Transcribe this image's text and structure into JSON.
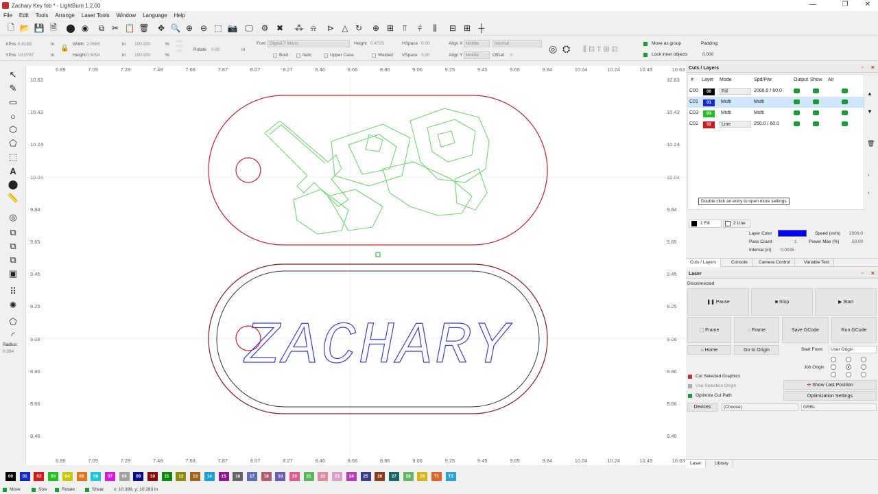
{
  "window": {
    "title": "Zachary Key fob * - LightBurn 1.2.00",
    "minimize": "—",
    "maximize": "❐",
    "close": "✕"
  },
  "menu": [
    "File",
    "Edit",
    "Tools",
    "Arrange",
    "Laser Tools",
    "Window",
    "Language",
    "Help"
  ],
  "toolbar2": {
    "xpos_label": "XPos",
    "xpos_value": "6.8189",
    "xpos_unit": "in",
    "ypos_label": "YPos",
    "ypos_value": "10.0787",
    "ypos_unit": "in",
    "width_label": "Width",
    "width_value": "2.0665",
    "width_unit": "in",
    "width_pct": "100.000",
    "width_pct_unit": "%",
    "height_label": "Height",
    "height_value": "0.9094",
    "height_unit": "in",
    "height_pct": "100.000",
    "height_pct_unit": "%",
    "rotate_label": "Rotate",
    "rotate_value": "0.00",
    "rotate_unit": "in",
    "font_label": "Font",
    "font_value": "Digital-7 Mono",
    "fheight_label": "Height",
    "fheight_value": "0.4725",
    "hspace_label": "HSpace",
    "hspace_value": "0.00",
    "vspace_label": "VSpace",
    "vspace_value": "0.00",
    "bold": "Bold",
    "italic": "Italic",
    "upper": "Upper Case",
    "welded": "Welded",
    "alignx_label": "Align X",
    "alignx_value": "Middle",
    "aligny_label": "Align Y",
    "aligny_value": "Middle",
    "normal": "Normal",
    "offset_label": "Offset",
    "offset_value": "0",
    "move_group": "Move as group",
    "lock_inner": "Lock inner objects",
    "padding_label": "Padding:",
    "padding_value": "0.000"
  },
  "rulers": {
    "top": [
      "6.89",
      "7.09",
      "7.28",
      "7.48",
      "7.68",
      "7.87",
      "8.07",
      "8.27",
      "8.46",
      "8.66",
      "8.86",
      "9.06",
      "9.25",
      "9.45",
      "9.65",
      "9.84",
      "10.04",
      "10.24",
      "10.43",
      "10.63"
    ],
    "left": [
      "10.63",
      "10.43",
      "10.24",
      "10.04",
      "9.84",
      "9.65",
      "9.45",
      "9.25",
      "9.06",
      "8.86",
      "8.66",
      "8.46"
    ]
  },
  "canvas": {
    "name_text": "ZACHARY"
  },
  "left_tools": {
    "radius_label": "Radius:",
    "radius_value": "0.394"
  },
  "cuts_layers": {
    "title": "Cuts / Layers",
    "headers": {
      "num": "#",
      "layer": "Layer",
      "mode": "Mode",
      "spdpwr": "Spd/Pwr",
      "output": "Output",
      "show": "Show",
      "air": "Air"
    },
    "rows": [
      {
        "num": "C00",
        "layer": "00",
        "mode": "Fill",
        "spdpwr": "2000.0 / 60.0",
        "color": "#000000"
      },
      {
        "num": "C01",
        "layer": "01",
        "mode": "Multi",
        "spdpwr": "Multi",
        "color": "#1428d8"
      },
      {
        "num": "C03",
        "layer": "03",
        "mode": "Multi",
        "spdpwr": "Multi",
        "color": "#22c022"
      },
      {
        "num": "C02",
        "layer": "02",
        "mode": "Line",
        "spdpwr": "250.0 / 60.0",
        "color": "#d81818"
      }
    ],
    "hint": "Double click an entry to open more settings",
    "tab_fill": "1 Fill",
    "tab_line": "2 Line",
    "layer_color_label": "Layer Color",
    "layer_color": "#0000ff",
    "speed_label": "Speed (in/m)",
    "speed_value": "2000.0",
    "pass_label": "Pass Count",
    "pass_value": "1",
    "maxpow_label": "Power Max (%)",
    "maxpow_value": "50.00",
    "interval_label": "Interval (in)",
    "interval_value": "0.0035",
    "tabs": [
      "Cuts / Layers",
      "Console",
      "Camera Control",
      "Variable Text"
    ]
  },
  "laser": {
    "title": "Laser",
    "status": "Disconnected",
    "pause": "Pause",
    "stop": "Stop",
    "start": "Start",
    "frame1": "Frame",
    "frame2": "Frame",
    "save_gcode": "Save GCode",
    "run_gcode": "Run GCode",
    "home": "Home",
    "goto_origin": "Go to Origin",
    "start_from_label": "Start From:",
    "start_from_value": "User Origin",
    "job_origin_label": "Job Origin",
    "cut_selected": "Cut Selected Graphics",
    "use_selection": "Use Selection Origin",
    "optimize": "Optimize Cut Path",
    "show_last": "Show Last Position",
    "opt_settings": "Optimization Settings",
    "devices": "Devices",
    "device_value": "(Choose)",
    "grbl": "GRBL",
    "bottom_tabs": [
      "Laser",
      "Library"
    ]
  },
  "palette": [
    {
      "label": "00",
      "color": "#000000"
    },
    {
      "label": "01",
      "color": "#1428d8"
    },
    {
      "label": "02",
      "color": "#d81818"
    },
    {
      "label": "03",
      "color": "#22c022"
    },
    {
      "label": "04",
      "color": "#c8c800"
    },
    {
      "label": "05",
      "color": "#e07818"
    },
    {
      "label": "06",
      "color": "#18c8d8"
    },
    {
      "label": "07",
      "color": "#d818d8"
    },
    {
      "label": "08",
      "color": "#a0a0a0"
    },
    {
      "label": "09",
      "color": "#0a0a8c"
    },
    {
      "label": "10",
      "color": "#8c0a0a"
    },
    {
      "label": "11",
      "color": "#0a8c0a"
    },
    {
      "label": "12",
      "color": "#8c8c0a"
    },
    {
      "label": "13",
      "color": "#a06418"
    },
    {
      "label": "14",
      "color": "#18a0d8"
    },
    {
      "label": "15",
      "color": "#8c188c"
    },
    {
      "label": "16",
      "color": "#646464"
    },
    {
      "label": "17",
      "color": "#5a6eb4"
    },
    {
      "label": "18",
      "color": "#b45a6e"
    },
    {
      "label": "19",
      "color": "#6e5ab4"
    },
    {
      "label": "20",
      "color": "#e05a8c"
    },
    {
      "label": "21",
      "color": "#5ab45a"
    },
    {
      "label": "22",
      "color": "#e08ca0"
    },
    {
      "label": "23",
      "color": "#d8a0c8"
    },
    {
      "label": "24",
      "color": "#b43cb4"
    },
    {
      "label": "25",
      "color": "#3c3c8c"
    },
    {
      "label": "26",
      "color": "#8c3c18"
    },
    {
      "label": "27",
      "color": "#186464"
    },
    {
      "label": "28",
      "color": "#64b464"
    },
    {
      "label": "29",
      "color": "#d8b418"
    },
    {
      "label": "T1",
      "color": "#e06428"
    },
    {
      "label": "T2",
      "color": "#28a0d8"
    }
  ],
  "statusbar": {
    "move": "Move",
    "size": "Size",
    "rotate": "Rotate",
    "shear": "Shear",
    "coords": "x: 10.399, y: 10.283 in"
  }
}
